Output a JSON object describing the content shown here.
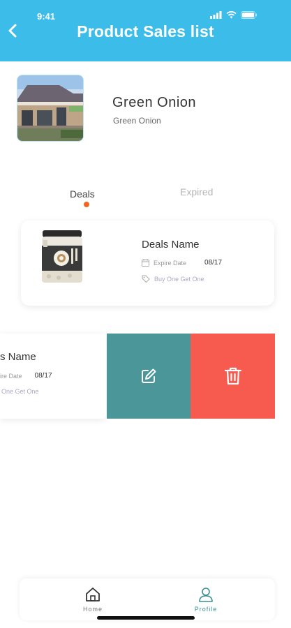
{
  "status_bar": {
    "time": "9:41"
  },
  "header": {
    "title": "Product Sales list"
  },
  "store": {
    "name": "Green Onion",
    "subtitle": "Green Onion"
  },
  "tabs": [
    {
      "label": "Deals",
      "active": true
    },
    {
      "label": "Expired",
      "active": false
    }
  ],
  "deals": [
    {
      "name": "Deals Name",
      "expire_label": "Expire Date",
      "expire_value": "08/17",
      "promo": "Buy One Get One"
    },
    {
      "name": "s Name",
      "expire_label": "ire Date",
      "expire_value": "08/17",
      "promo": "One Get One"
    }
  ],
  "nav": {
    "home_label": "Home",
    "profile_label": "Profile"
  },
  "colors": {
    "header": "#3cbde9",
    "active_dot": "#f26522",
    "edit_action": "#4b9699",
    "delete_action": "#f75a4f",
    "nav_home": "#333333",
    "nav_profile": "#3a8f93"
  },
  "icons": {
    "back": "chevron-left-icon",
    "edit": "edit-icon",
    "delete": "trash-icon",
    "home": "home-icon",
    "profile": "user-icon",
    "calendar": "calendar-icon",
    "tag": "tag-icon"
  }
}
